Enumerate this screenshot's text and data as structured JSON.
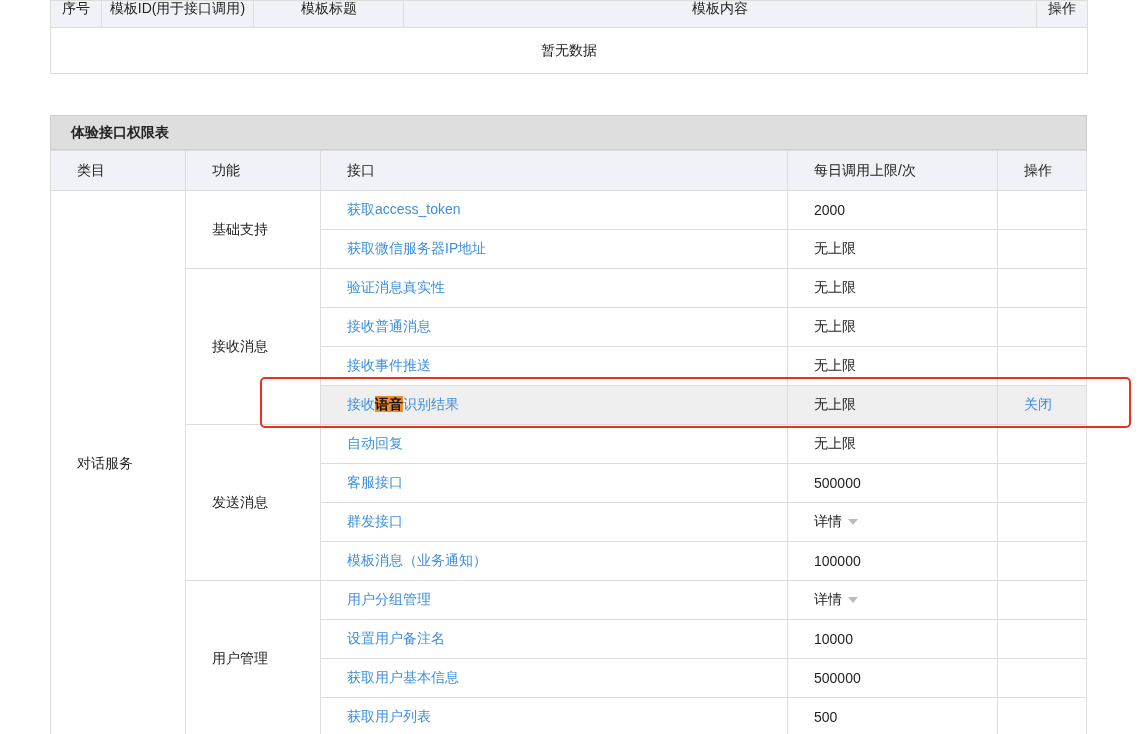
{
  "template_table": {
    "columns": [
      "序号",
      "模板ID(用于接口调用)",
      "模板标题",
      "模板内容",
      "操作"
    ],
    "empty_text": "暂无数据"
  },
  "permission_table": {
    "title": "体验接口权限表",
    "columns": [
      "类目",
      "功能",
      "接口",
      "每日调用上限/次",
      "操作"
    ],
    "categories": [
      {
        "name": "对话服务",
        "groups": [
          {
            "name": "基础支持",
            "apis": [
              {
                "name": "获取access_token",
                "limit": "2000",
                "kind": "text",
                "selected": false
              },
              {
                "name": "获取微信服务器IP地址",
                "limit": "无上限",
                "kind": "text",
                "selected": false
              }
            ]
          },
          {
            "name": "接收消息",
            "apis": [
              {
                "name": "验证消息真实性",
                "limit": "无上限",
                "kind": "text",
                "selected": false
              },
              {
                "name": "接收普通消息",
                "limit": "无上限",
                "kind": "text",
                "selected": false
              },
              {
                "name": "接收事件推送",
                "limit": "无上限",
                "kind": "text",
                "selected": false
              },
              {
                "name": "接收**语音**识别结果",
                "limit": "无上限",
                "kind": "text",
                "action": "关闭",
                "selected": true
              }
            ]
          },
          {
            "name": "发送消息",
            "apis": [
              {
                "name": "自动回复",
                "limit": "无上限",
                "kind": "text",
                "selected": false
              },
              {
                "name": "客服接口",
                "limit": "500000",
                "kind": "text",
                "selected": false
              },
              {
                "name": "群发接口",
                "limit": "详情",
                "kind": "dropdown",
                "selected": false
              },
              {
                "name": "模板消息（业务通知）",
                "limit": "100000",
                "kind": "text",
                "selected": false
              }
            ]
          },
          {
            "name": "用户管理",
            "apis": [
              {
                "name": "用户分组管理",
                "limit": "详情",
                "kind": "dropdown",
                "selected": false
              },
              {
                "name": "设置用户备注名",
                "limit": "10000",
                "kind": "text",
                "selected": false
              },
              {
                "name": "获取用户基本信息",
                "limit": "500000",
                "kind": "text",
                "selected": false
              },
              {
                "name": "获取用户列表",
                "limit": "500",
                "kind": "text",
                "selected": false
              }
            ]
          }
        ]
      }
    ]
  }
}
